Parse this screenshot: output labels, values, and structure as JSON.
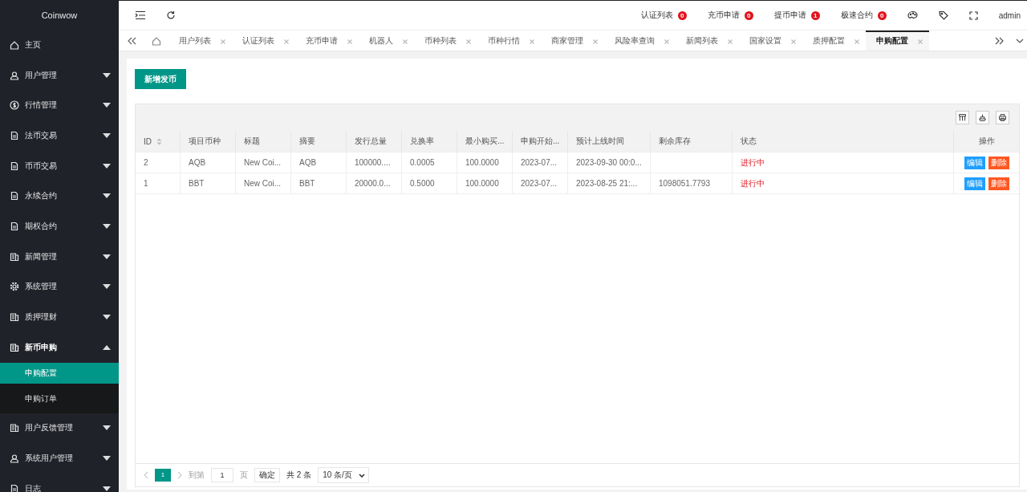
{
  "brand": "Coinwow",
  "sidebar": {
    "items": [
      {
        "label": "主页",
        "has_arrow": false,
        "expanded": false
      },
      {
        "label": "用户管理",
        "has_arrow": true,
        "expanded": false
      },
      {
        "label": "行情管理",
        "has_arrow": true,
        "expanded": false
      },
      {
        "label": "法币交易",
        "has_arrow": true,
        "expanded": false
      },
      {
        "label": "币币交易",
        "has_arrow": true,
        "expanded": false
      },
      {
        "label": "永续合约",
        "has_arrow": true,
        "expanded": false
      },
      {
        "label": "期权合约",
        "has_arrow": true,
        "expanded": false
      },
      {
        "label": "新闻管理",
        "has_arrow": true,
        "expanded": false
      },
      {
        "label": "系统管理",
        "has_arrow": true,
        "expanded": false
      },
      {
        "label": "质押理财",
        "has_arrow": true,
        "expanded": false
      },
      {
        "label": "新币申购",
        "has_arrow": true,
        "expanded": true,
        "children": [
          {
            "label": "申购配置",
            "selected": true
          },
          {
            "label": "申购订单",
            "selected": false
          }
        ]
      },
      {
        "label": "用户反馈管理",
        "has_arrow": true,
        "expanded": false
      },
      {
        "label": "系统用户管理",
        "has_arrow": true,
        "expanded": false
      },
      {
        "label": "日志",
        "has_arrow": true,
        "expanded": false
      }
    ]
  },
  "header": {
    "notices": [
      {
        "label": "认证列表",
        "count": "0"
      },
      {
        "label": "充币申请",
        "count": "0"
      },
      {
        "label": "提币申请",
        "count": "1"
      },
      {
        "label": "极速合约",
        "count": "0"
      }
    ],
    "user": "admin"
  },
  "tabs": [
    {
      "label": "用户列表",
      "selected": false
    },
    {
      "label": "认证列表",
      "selected": false
    },
    {
      "label": "充币申请",
      "selected": false
    },
    {
      "label": "机器人",
      "selected": false
    },
    {
      "label": "币种列表",
      "selected": false
    },
    {
      "label": "币种行情",
      "selected": false
    },
    {
      "label": "商家管理",
      "selected": false
    },
    {
      "label": "风险率查询",
      "selected": false
    },
    {
      "label": "新闻列表",
      "selected": false
    },
    {
      "label": "国家设置",
      "selected": false
    },
    {
      "label": "质押配置",
      "selected": false
    },
    {
      "label": "申购配置",
      "selected": true
    }
  ],
  "add_button": "新增发币",
  "table": {
    "columns": [
      "ID",
      "项目币种",
      "标题",
      "摘要",
      "发行总量",
      "兑换率",
      "最小购买...",
      "申购开始...",
      "预计上线时间",
      "剩余库存",
      "状态",
      "操作"
    ],
    "rows": [
      {
        "cells": [
          "2",
          "AQB",
          "New Coi...",
          "AQB",
          "100000....",
          "0.0005",
          "100.0000",
          "2023-07...",
          "2023-09-30 00:0...",
          ""
        ],
        "status": "进行中",
        "actions": [
          "编辑",
          "删除"
        ]
      },
      {
        "cells": [
          "1",
          "BBT",
          "New Coi...",
          "BBT",
          "20000.0...",
          "0.5000",
          "100.0000",
          "2023-07...",
          "2023-08-25 21:...",
          "1098051.7793"
        ],
        "status": "进行中",
        "actions": [
          "编辑",
          "删除"
        ]
      }
    ]
  },
  "pagination": {
    "current": "1",
    "goto_label": "到第",
    "page_value": "1",
    "page_unit": "页",
    "confirm": "确定",
    "total": "共 2 条",
    "page_size": "10 条/页"
  }
}
